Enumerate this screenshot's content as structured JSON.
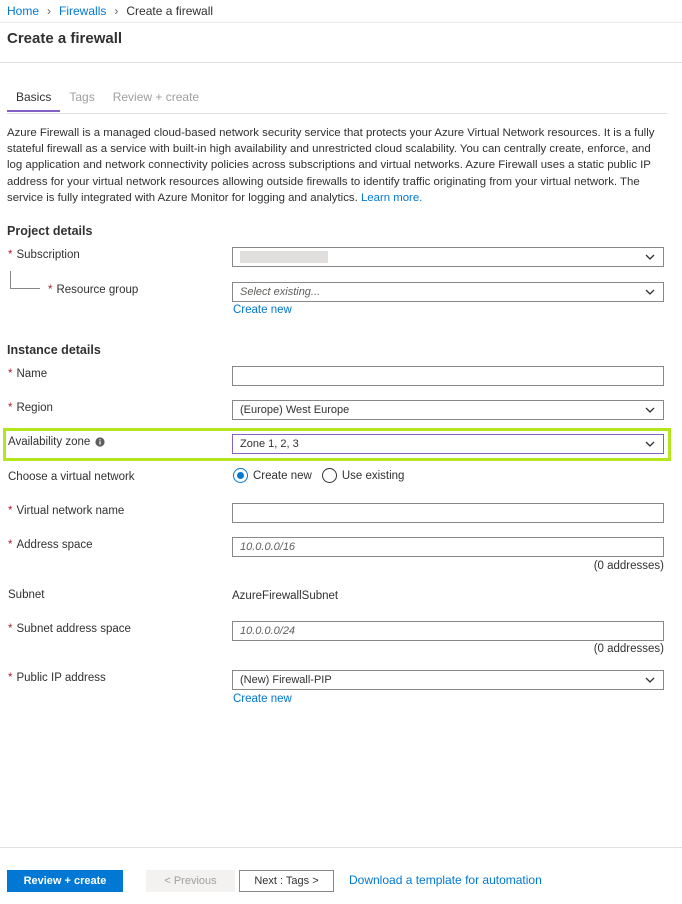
{
  "breadcrumb": {
    "items": [
      "Home",
      "Firewalls",
      "Create a firewall"
    ]
  },
  "page": {
    "title": "Create a firewall"
  },
  "tabs": [
    {
      "label": "Basics",
      "active": true
    },
    {
      "label": "Tags",
      "active": false
    },
    {
      "label": "Review + create",
      "active": false
    }
  ],
  "description": {
    "text": "Azure Firewall is a managed cloud-based network security service that protects your Azure Virtual Network resources. It is a fully stateful firewall as a service with built-in high availability and unrestricted cloud scalability. You can centrally create, enforce, and log application and network connectivity policies across subscriptions and virtual networks. Azure Firewall uses a static public IP address for your virtual network resources allowing outside firewalls to identify traffic originating from your virtual network. The service is fully integrated with Azure Monitor for logging and analytics.",
    "learn_more": "Learn more."
  },
  "project_details": {
    "title": "Project details",
    "subscription_label": "Subscription",
    "resource_group_label": "Resource group",
    "resource_group_placeholder": "Select existing...",
    "create_new": "Create new"
  },
  "instance_details": {
    "title": "Instance details",
    "name_label": "Name",
    "name_value": "",
    "region_label": "Region",
    "region_value": "(Europe) West Europe",
    "zone_label": "Availability zone",
    "zone_value": "Zone 1, 2, 3",
    "vnet_label": "Choose a virtual network",
    "vnet_options": [
      "Create new",
      "Use existing"
    ],
    "vnet_selected": "Create new",
    "vnet_name_label": "Virtual network name",
    "vnet_name_value": "",
    "address_space_label": "Address space",
    "address_space_placeholder": "10.0.0.0/16",
    "address_space_note": "(0 addresses)",
    "subnet_label": "Subnet",
    "subnet_value": "AzureFirewallSubnet",
    "subnet_space_label": "Subnet address space",
    "subnet_space_placeholder": "10.0.0.0/24",
    "subnet_space_note": "(0 addresses)",
    "public_ip_label": "Public IP address",
    "public_ip_value": "(New) Firewall-PIP",
    "public_ip_create_new": "Create new"
  },
  "footer": {
    "review_create": "Review + create",
    "previous": "< Previous",
    "next": "Next : Tags >",
    "download": "Download a template for automation"
  },
  "colors": {
    "accent": "#0078d4",
    "tab_underline": "#8661c5",
    "required": "#a4262c",
    "highlight": "#b5e61d"
  }
}
